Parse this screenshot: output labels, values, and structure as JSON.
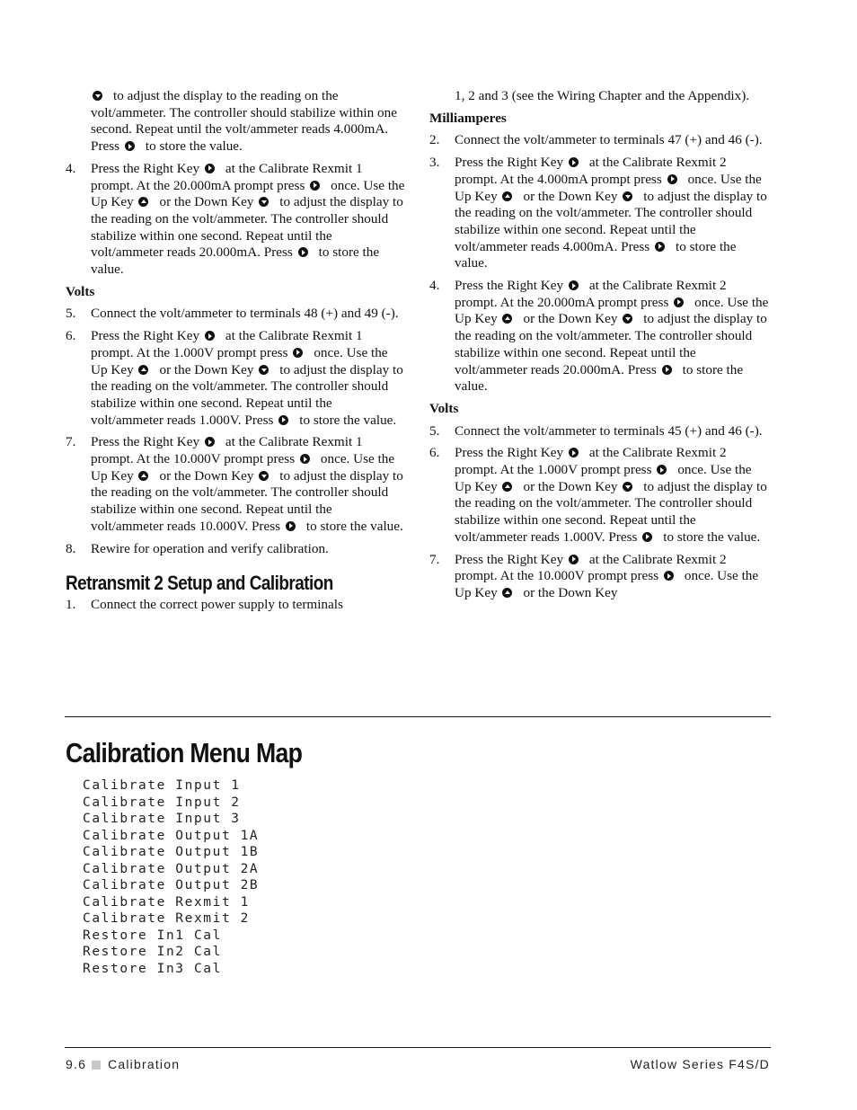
{
  "left_column": {
    "continuation": [
      {
        "icon": "down"
      },
      {
        "text": "to adjust the display to the reading on the volt/ammeter. The controller should stabilize within one second. Repeat until the volt/ammeter reads 4.000mA. Press"
      },
      {
        "icon": "right"
      },
      {
        "text": "to store the value."
      }
    ],
    "steps_milliamps_end": [
      {
        "num": "4.",
        "parts": [
          {
            "text": "Press the Right Key"
          },
          {
            "icon": "right"
          },
          {
            "text": "at the Calibrate Rexmit 1 prompt. At the 20.000mA prompt press"
          },
          {
            "icon": "right"
          },
          {
            "text": "once. Use the Up Key"
          },
          {
            "icon": "up"
          },
          {
            "text": "or the Down Key"
          },
          {
            "icon": "down"
          },
          {
            "text": "to adjust the display to the reading on the volt/ammeter. The controller should stabilize within one second. Repeat until the volt/ammeter reads 20.000mA. Press"
          },
          {
            "icon": "right"
          },
          {
            "text": "to store the value."
          }
        ]
      }
    ],
    "volts_heading": "Volts",
    "volts_steps": [
      {
        "num": "5.",
        "parts": [
          {
            "text": "Connect the volt/ammeter to terminals 48 (+) and 49 (-)."
          }
        ]
      },
      {
        "num": "6.",
        "parts": [
          {
            "text": "Press the Right Key"
          },
          {
            "icon": "right"
          },
          {
            "text": "at the Calibrate Rexmit 1 prompt. At the 1.000V prompt press"
          },
          {
            "icon": "right"
          },
          {
            "text": "once. Use the Up Key"
          },
          {
            "icon": "up"
          },
          {
            "text": "or the Down Key"
          },
          {
            "icon": "down"
          },
          {
            "text": "to adjust the display to the reading on the volt/ammeter. The controller should stabilize within one second. Repeat until the volt/ammeter reads 1.000V. Press"
          },
          {
            "icon": "right"
          },
          {
            "text": "to store the value."
          }
        ]
      },
      {
        "num": "7.",
        "parts": [
          {
            "text": "Press the Right Key"
          },
          {
            "icon": "right"
          },
          {
            "text": "at the Calibrate Rexmit 1 prompt. At the 10.000V prompt press"
          },
          {
            "icon": "right"
          },
          {
            "text": "once. Use the Up Key"
          },
          {
            "icon": "up"
          },
          {
            "text": "or the Down Key"
          },
          {
            "icon": "down"
          },
          {
            "text": "to adjust the display to the reading on the volt/ammeter. The controller should stabilize within one second. Repeat until the volt/ammeter reads 10.000V. Press"
          },
          {
            "icon": "right"
          },
          {
            "text": "to store the value."
          }
        ]
      },
      {
        "num": "8.",
        "parts": [
          {
            "text": "Rewire for operation and verify calibration."
          }
        ]
      }
    ],
    "section_heading": "Retransmit 2 Setup and Calibration",
    "section_steps": [
      {
        "num": "1.",
        "parts": [
          {
            "text": "Connect the correct power supply to terminals"
          }
        ]
      }
    ]
  },
  "right_column": {
    "continuation": [
      {
        "text": "1, 2 and 3 (see the Wiring Chapter and the Appendix)."
      }
    ],
    "milliamps_heading": "Milliamperes",
    "milliamps_steps": [
      {
        "num": "2.",
        "parts": [
          {
            "text": "Connect the volt/ammeter to terminals 47 (+) and 46 (-)."
          }
        ]
      },
      {
        "num": "3.",
        "parts": [
          {
            "text": "Press the Right Key"
          },
          {
            "icon": "right"
          },
          {
            "text": "at the Calibrate Rexmit 2 prompt. At the 4.000mA prompt press"
          },
          {
            "icon": "right"
          },
          {
            "text": "once. Use the Up Key"
          },
          {
            "icon": "up"
          },
          {
            "text": "or the Down Key"
          },
          {
            "icon": "down"
          },
          {
            "text": "to adjust the display to the reading on the volt/ammeter. The controller should stabilize within one second. Repeat until the volt/ammeter reads 4.000mA. Press"
          },
          {
            "icon": "right"
          },
          {
            "text": "to store the value."
          }
        ]
      },
      {
        "num": "4.",
        "parts": [
          {
            "text": "Press the Right Key"
          },
          {
            "icon": "right"
          },
          {
            "text": "at the Calibrate Rexmit 2 prompt. At the 20.000mA prompt press"
          },
          {
            "icon": "right"
          },
          {
            "text": "once. Use the Up Key"
          },
          {
            "icon": "up"
          },
          {
            "text": "or the Down Key"
          },
          {
            "icon": "down"
          },
          {
            "text": "to adjust the display to the reading on the volt/ammeter. The controller should stabilize within one second. Repeat until the volt/ammeter reads 20.000mA. Press"
          },
          {
            "icon": "right"
          },
          {
            "text": "to store the value."
          }
        ]
      }
    ],
    "volts_heading": "Volts",
    "volts_steps": [
      {
        "num": "5.",
        "parts": [
          {
            "text": "Connect the volt/ammeter to terminals 45 (+) and 46 (-)."
          }
        ]
      },
      {
        "num": "6.",
        "parts": [
          {
            "text": "Press the Right Key"
          },
          {
            "icon": "right"
          },
          {
            "text": "at the Calibrate Rexmit 2 prompt. At the 1.000V prompt press"
          },
          {
            "icon": "right"
          },
          {
            "text": "once. Use the Up Key"
          },
          {
            "icon": "up"
          },
          {
            "text": "or the Down Key"
          },
          {
            "icon": "down"
          },
          {
            "text": "to adjust the display to the reading on the volt/ammeter. The controller should stabilize within one second. Repeat until the volt/ammeter reads 1.000V. Press"
          },
          {
            "icon": "right"
          },
          {
            "text": "to store the value."
          }
        ]
      },
      {
        "num": "7.",
        "parts": [
          {
            "text": "Press the Right Key"
          },
          {
            "icon": "right"
          },
          {
            "text": "at the Calibrate Rexmit 2 prompt. At the 10.000V prompt press"
          },
          {
            "icon": "right"
          },
          {
            "text": "once. Use the Up Key"
          },
          {
            "icon": "up"
          },
          {
            "text": "or the Down Key"
          }
        ]
      }
    ]
  },
  "menu_map": {
    "title": "Calibration Menu Map",
    "items": [
      "Calibrate Input 1",
      "Calibrate Input 2",
      "Calibrate Input 3",
      "Calibrate Output 1A",
      "Calibrate Output 1B",
      "Calibrate Output 2A",
      "Calibrate Output 2B",
      "Calibrate Rexmit 1",
      "Calibrate Rexmit 2",
      "Restore In1 Cal",
      "Restore In2 Cal",
      "Restore In3 Cal"
    ]
  },
  "footer": {
    "page_number": "9.6",
    "chapter": "Calibration",
    "product": "Watlow Series F4S/D"
  },
  "icons": {
    "right": "right-key-icon",
    "up": "up-key-icon",
    "down": "down-key-icon"
  }
}
